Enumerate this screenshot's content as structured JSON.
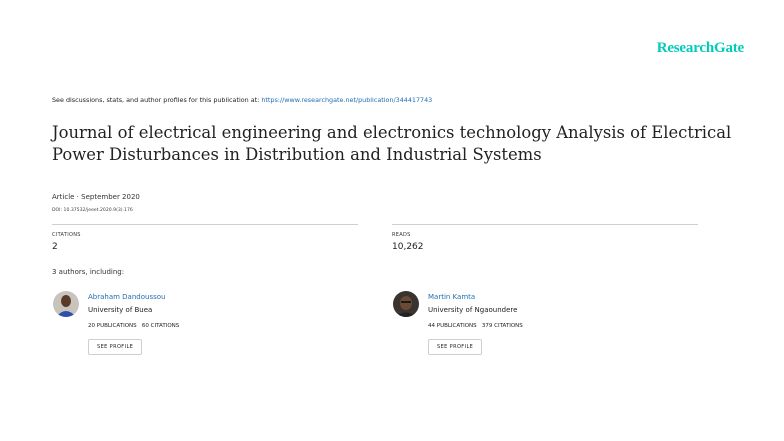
{
  "brand": {
    "logo_text": "ResearchGate",
    "accent": "#00ccbb",
    "link_color": "#1f6fb2"
  },
  "header": {
    "see_prefix": "See discussions, stats, and author profiles for this publication at:",
    "see_url": "https://www.researchgate.net/publication/344417743"
  },
  "publication": {
    "title": "Journal of electrical engineering and electronics technology Analysis of Electrical Power Disturbances in Distribution and Industrial Systems",
    "meta": "Article · September 2020",
    "doi": "DOI: 10.37532/jeeet.2020.9(3).176"
  },
  "stats": {
    "citations_label": "CITATIONS",
    "citations_value": "2",
    "reads_label": "READS",
    "reads_value": "10,262"
  },
  "authors_heading": "3 authors, including:",
  "authors": [
    {
      "name": "Abraham Dandoussou",
      "institution": "University of Buea",
      "publications": "20 PUBLICATIONS",
      "citations": "60 CITATIONS",
      "button": "SEE PROFILE"
    },
    {
      "name": "Martin Kamta",
      "institution": "University of Ngaoundere",
      "publications": "44 PUBLICATIONS",
      "citations": "379 CITATIONS",
      "button": "SEE PROFILE"
    }
  ]
}
